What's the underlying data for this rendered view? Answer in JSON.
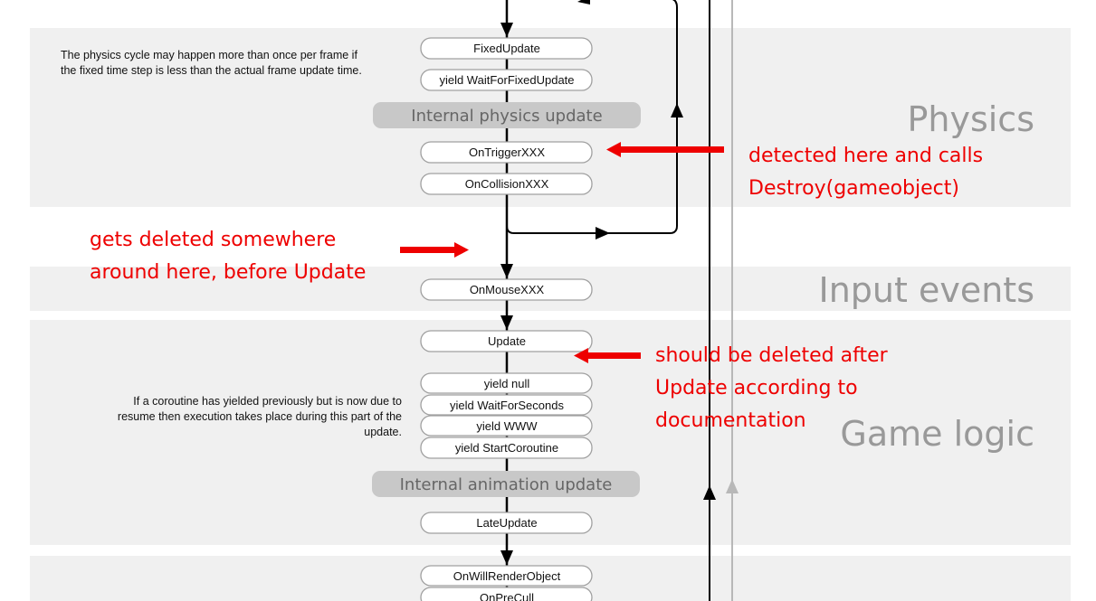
{
  "sections": {
    "physics": "Physics",
    "input": "Input events",
    "game_logic": "Game logic"
  },
  "notes": {
    "physics": [
      "The physics cycle may happen more than once per frame if",
      "the fixed time step is less than the actual frame update time."
    ],
    "coroutine": [
      "If a coroutine has yielded previously but is now due to",
      "resume then execution takes place during this part of the",
      "update."
    ]
  },
  "boxes": {
    "fixed_update": "FixedUpdate",
    "wait_fixed": "yield WaitForFixedUpdate",
    "physics_internal": "Internal physics update",
    "trigger": "OnTriggerXXX",
    "collision": "OnCollisionXXX",
    "mouse": "OnMouseXXX",
    "update": "Update",
    "yield_null": "yield null",
    "yield_seconds": "yield WaitForSeconds",
    "yield_www": "yield WWW",
    "yield_coroutine": "yield StartCoroutine",
    "animation_internal": "Internal animation update",
    "late_update": "LateUpdate",
    "will_render": "OnWillRenderObject",
    "pre_cull": "OnPreCull"
  },
  "annotations": {
    "detected": [
      "detected here and calls",
      "Destroy(gameobject)"
    ],
    "deleted": [
      "gets deleted somewhere",
      "around here, before Update"
    ],
    "should": [
      "should be deleted after",
      "Update according to",
      "documentation"
    ]
  },
  "colors": {
    "annotation": "#ee0000",
    "panel": "#f0f0f0",
    "heading": "#999999"
  }
}
